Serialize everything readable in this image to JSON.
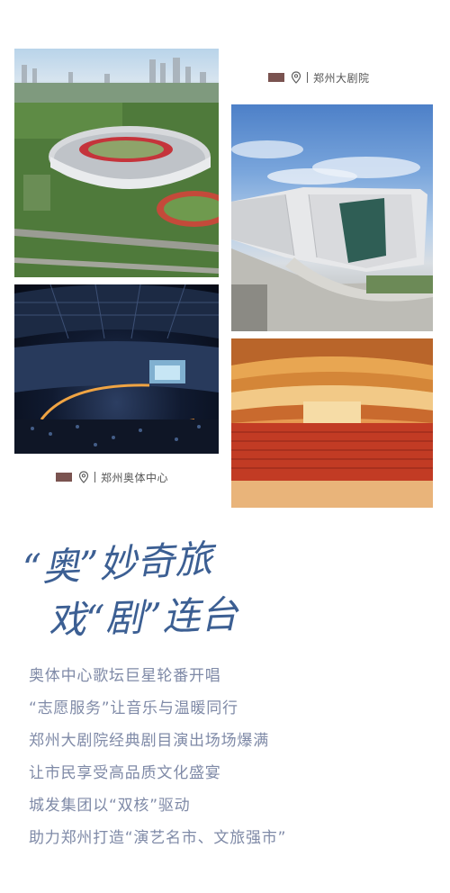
{
  "captions": {
    "theater": "郑州大剧院",
    "sports_center": "郑州奥体中心"
  },
  "slogan": {
    "line1": "“奥”妙奇旅",
    "line2": "戏“剧”连台"
  },
  "body_lines": [
    "奥体中心歌坛巨星轮番开唱",
    "“志愿服务”让音乐与温暖同行",
    "郑州大剧院经典剧目演出场场爆满",
    "让市民享受高品质文化盛宴",
    "城发集团以“双核”驱动",
    "助力郑州打造“演艺名市、文旅强市”"
  ],
  "colors": {
    "accent_square": "#7a5350",
    "caption_text": "#555555",
    "body_text": "#7f8aa7",
    "slogan_ink": "#3c5f93"
  }
}
